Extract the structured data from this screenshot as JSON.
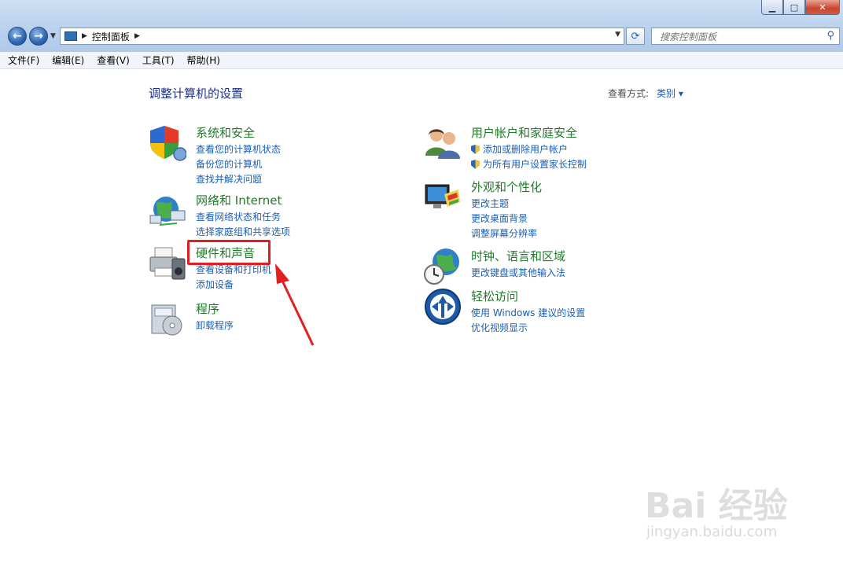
{
  "window": {
    "address_path": [
      "控制面板"
    ],
    "search_placeholder": "搜索控制面板",
    "buttons": {
      "minimize": "▁",
      "maximize": "□",
      "close": "✕"
    }
  },
  "menu": [
    "文件(F)",
    "编辑(E)",
    "查看(V)",
    "工具(T)",
    "帮助(H)"
  ],
  "page": {
    "title": "调整计算机的设置",
    "view_by_label": "查看方式:",
    "view_by_value": "类别 ▾"
  },
  "categories_left": [
    {
      "title": "系统和安全",
      "icon": "shield-icon",
      "links": [
        "查看您的计算机状态",
        "备份您的计算机",
        "查找并解决问题"
      ]
    },
    {
      "title": "网络和 Internet",
      "icon": "network-globe-icon",
      "links": [
        "查看网络状态和任务",
        "选择家庭组和共享选项"
      ]
    },
    {
      "title": "硬件和声音",
      "icon": "printer-icon",
      "links": [
        "查看设备和打印机",
        "添加设备"
      ]
    },
    {
      "title": "程序",
      "icon": "programs-icon",
      "links": [
        "卸载程序"
      ]
    }
  ],
  "categories_right": [
    {
      "title": "用户帐户和家庭安全",
      "icon": "users-icon",
      "links": [
        "添加或删除用户帐户",
        "为所有用户设置家长控制"
      ]
    },
    {
      "title": "外观和个性化",
      "icon": "monitor-palette-icon",
      "links": [
        "更改主题",
        "更改桌面背景",
        "调整屏幕分辨率"
      ]
    },
    {
      "title": "时钟、语言和区域",
      "icon": "clock-globe-icon",
      "links": [
        "更改键盘或其他输入法"
      ]
    },
    {
      "title": "轻松访问",
      "icon": "ease-of-access-icon",
      "links": [
        "使用 Windows 建议的设置",
        "优化视频显示"
      ]
    }
  ],
  "watermark": {
    "brand": "Bai 经验",
    "url": "jingyan.baidu.com"
  },
  "colors": {
    "title_green": "#217a2a",
    "link_blue": "#1a5fb4",
    "highlight_red": "#e02020"
  }
}
